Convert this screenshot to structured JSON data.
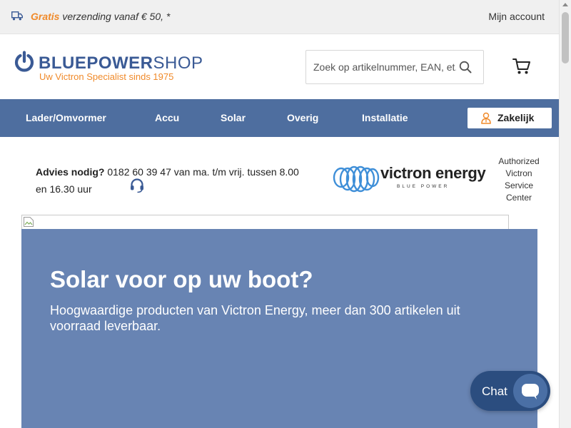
{
  "topbar": {
    "shipping_highlight": "Gratis",
    "shipping_text": " verzending vanaf € 50,  *",
    "account_link": "Mijn account"
  },
  "header": {
    "logo_bold": "BLUEPOWER",
    "logo_light": "SHOP",
    "tagline": "Uw Victron Specialist sinds 1975",
    "search_placeholder": "Zoek op artikelnummer, EAN, et..."
  },
  "nav": {
    "items": [
      "Lader/Omvormer",
      "Accu",
      "Solar",
      "Overig",
      "Installatie"
    ],
    "business_button": "Zakelijk"
  },
  "advice": {
    "label": "Advies nodig?",
    "text": " 0182 60 39 47 van ma. t/m vrij. tussen 8.00 en 16.30 uur"
  },
  "victron": {
    "wordmark": "victron energy",
    "subline": "BLUE POWER",
    "authorized": "Authorized Victron Service Center"
  },
  "hero": {
    "title": "Solar voor op uw boot?",
    "description": "Hoogwaardige producten van Victron Energy, meer dan 300 artikelen uit voorraad leverbaar."
  },
  "chat": {
    "label": "Chat"
  },
  "colors": {
    "brand_blue": "#3a5a95",
    "accent_orange": "#f08a2a",
    "nav_bg": "#4e6e9f",
    "hero_bg": "#6884b3",
    "chat_bg": "#2b4d7f"
  },
  "icons": [
    "truck-icon",
    "power-logo-icon",
    "search-icon",
    "cart-icon",
    "user-badge-icon",
    "headset-icon",
    "victron-logo-icon",
    "broken-image-icon",
    "chat-bubble-icon"
  ]
}
